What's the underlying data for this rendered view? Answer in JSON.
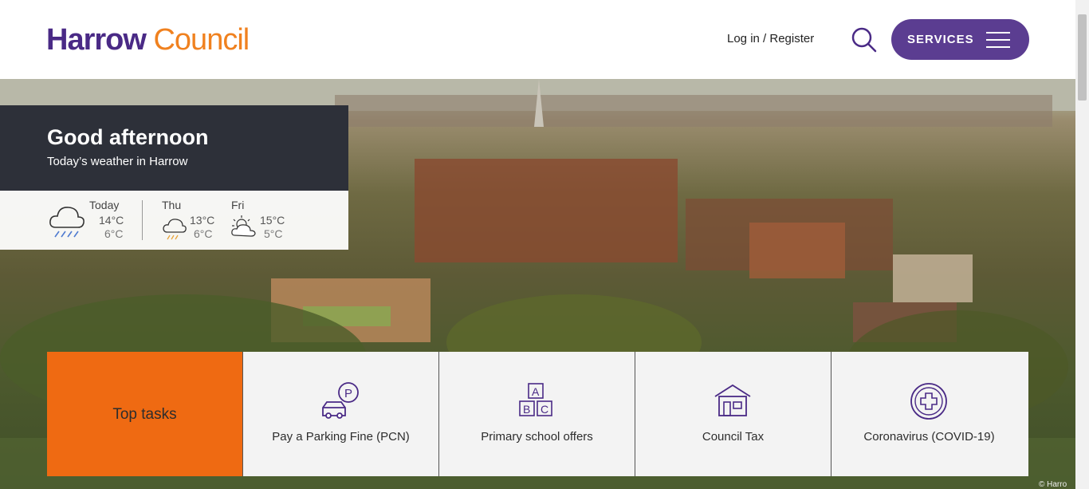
{
  "header": {
    "logo_part1": "Harrow",
    "logo_part2": "Council",
    "login_label": "Log in / Register",
    "services_label": "SERVICES"
  },
  "greeting": {
    "title": "Good afternoon",
    "subtitle": "Today’s weather in Harrow"
  },
  "weather": [
    {
      "day": "Today",
      "high": "14°C",
      "low": "6°C",
      "icon": "rain-cloud-icon"
    },
    {
      "day": "Thu",
      "high": "13°C",
      "low": "6°C",
      "icon": "rain-cloud-icon"
    },
    {
      "day": "Fri",
      "high": "15°C",
      "low": "5°C",
      "icon": "sun-cloud-icon"
    }
  ],
  "tasks": {
    "heading": "Top tasks",
    "items": [
      {
        "label": "Pay a Parking Fine (PCN)",
        "icon": "parking-car-icon"
      },
      {
        "label": "Primary school offers",
        "icon": "abc-blocks-icon"
      },
      {
        "label": "Council Tax",
        "icon": "house-icon"
      },
      {
        "label": "Coronavirus (COVID-19)",
        "icon": "medical-cross-icon"
      }
    ]
  },
  "photo_credit": "© Harro",
  "colors": {
    "brand_purple": "#4a2a86",
    "brand_orange": "#f0811f",
    "services_bg": "#5b3d91",
    "tasks_orange": "#ef6a12",
    "panel_dark": "#2d3039"
  }
}
